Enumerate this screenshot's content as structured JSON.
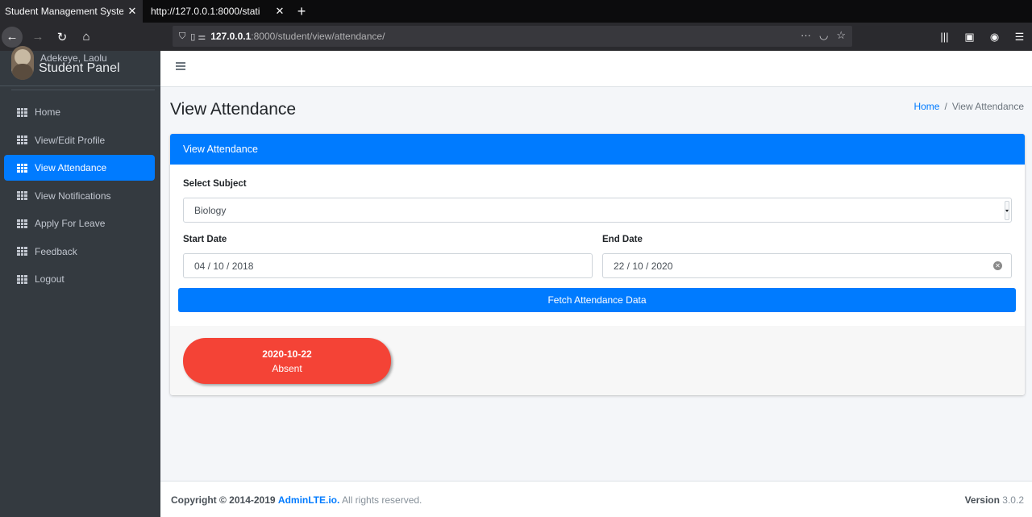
{
  "browser": {
    "tabs": [
      {
        "title": "Student Management Syste",
        "active": true
      },
      {
        "title": "http://127.0.0.1:8000/stati",
        "active": false
      }
    ],
    "url_host": "127.0.0.1",
    "url_path": ":8000/student/view/attendance/"
  },
  "sidebar": {
    "brand": "Student Panel",
    "user_name": "Adekeye, Laolu",
    "items": [
      {
        "label": "Home",
        "active": false
      },
      {
        "label": "View/Edit Profile",
        "active": false
      },
      {
        "label": "View Attendance",
        "active": true
      },
      {
        "label": "View Notifications",
        "active": false
      },
      {
        "label": "Apply For Leave",
        "active": false
      },
      {
        "label": "Feedback",
        "active": false
      },
      {
        "label": "Logout",
        "active": false
      }
    ]
  },
  "page": {
    "title": "View Attendance",
    "breadcrumb": {
      "home": "Home",
      "sep": "/",
      "current": "View Attendance"
    }
  },
  "card": {
    "header": "View Attendance",
    "subject_label": "Select Subject",
    "subject_value": "Biology",
    "start_label": "Start Date",
    "start_value": "04 / 10 / 2018",
    "end_label": "End Date",
    "end_value": "22 / 10 / 2020",
    "fetch_button": "Fetch Attendance Data",
    "records": [
      {
        "date": "2020-10-22",
        "status": "Absent",
        "color": "#f44336"
      }
    ]
  },
  "footer": {
    "copyright": "Copyright © 2014-2019",
    "brand": "AdminLTE.io.",
    "rights": "All rights reserved.",
    "version_label": "Version",
    "version": "3.0.2"
  },
  "colors": {
    "primary": "#007bff",
    "sidebar": "#343a40",
    "absent": "#f44336"
  }
}
